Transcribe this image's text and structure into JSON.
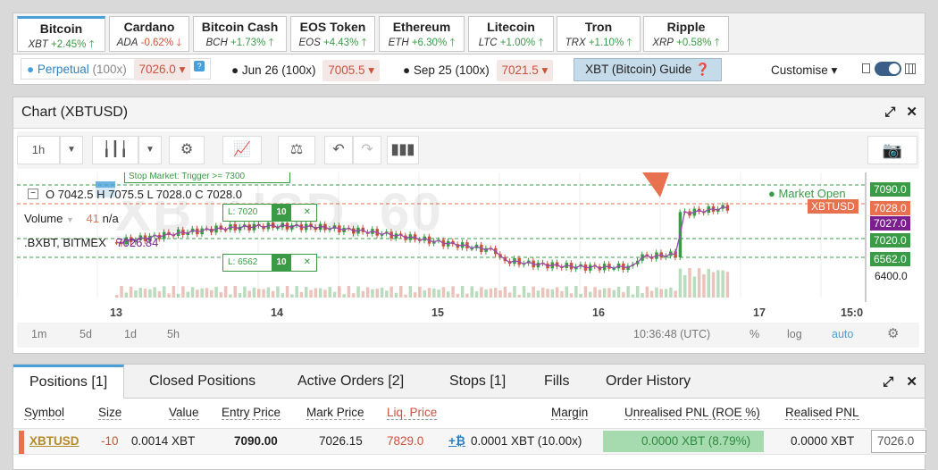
{
  "tabs": [
    {
      "name": "Bitcoin",
      "code": "XBT",
      "change": "+2.45%",
      "dir": "up",
      "arrow": "🡑"
    },
    {
      "name": "Cardano",
      "code": "ADA",
      "change": "-0.62%",
      "dir": "dn",
      "arrow": "🡓"
    },
    {
      "name": "Bitcoin Cash",
      "code": "BCH",
      "change": "+1.73%",
      "dir": "up",
      "arrow": "🡑"
    },
    {
      "name": "EOS Token",
      "code": "EOS",
      "change": "+4.43%",
      "dir": "up",
      "arrow": "🡑"
    },
    {
      "name": "Ethereum",
      "code": "ETH",
      "change": "+6.30%",
      "dir": "up",
      "arrow": "🡑"
    },
    {
      "name": "Litecoin",
      "code": "LTC",
      "change": "+1.00%",
      "dir": "up",
      "arrow": "🡑"
    },
    {
      "name": "Tron",
      "code": "TRX",
      "change": "+1.10%",
      "dir": "up",
      "arrow": "🡑"
    },
    {
      "name": "Ripple",
      "code": "XRP",
      "change": "+0.58%",
      "dir": "up",
      "arrow": "🡑"
    }
  ],
  "contracts": {
    "perpetual": {
      "label": "Perpetual",
      "lev": "(100x)",
      "price": "7026.0"
    },
    "jun": {
      "label": "Jun 26 (100x)",
      "price": "7005.5"
    },
    "sep": {
      "label": "Sep 25 (100x)",
      "price": "7021.5"
    },
    "guide": "XBT (Bitcoin) Guide",
    "customise": "Customise"
  },
  "chart": {
    "title": "Chart (XBTUSD)",
    "interval": "1h",
    "ohlc": "O 7042.5 H 7075.5 L 7028.0 C 7028.0",
    "volume_label": "Volume",
    "volume_val": "41",
    "volume_na": "n/a",
    "index": ".BXBT, BITMEX",
    "index_val": "7026.84",
    "watermark": "XBTUSD, 60",
    "market_open": "Market Open",
    "stop_label": "Stop Market: Trigger >= 7300",
    "ord1": "L: 7020",
    "ord1q": "10",
    "ord2": "L: 6562",
    "ord2q": "10",
    "times": [
      "1m",
      "5d",
      "1d",
      "5h"
    ],
    "clock": "10:36:48 (UTC)",
    "pct": "%",
    "log": "log",
    "auto": "auto",
    "price_badges": [
      {
        "v": "7090.0",
        "c": "#3a9a46"
      },
      {
        "v": "XBTUSD",
        "c": "#e8724f"
      },
      {
        "v": "7028.0",
        "c": "#e8724f"
      },
      {
        "v": "7027.0",
        "c": "#7b1f8f"
      },
      {
        "v": "7020.0",
        "c": "#3a9a46"
      },
      {
        "v": "6562.0",
        "c": "#3a9a46"
      }
    ],
    "axis_label": "6400.0",
    "dates": [
      "13",
      "14",
      "15",
      "16",
      "17",
      "15:0"
    ]
  },
  "positions": {
    "tabs": [
      "Positions [1]",
      "Closed Positions",
      "Active Orders [2]",
      "Stops [1]",
      "Fills",
      "Order History"
    ],
    "headers": [
      "Symbol",
      "Size",
      "Value",
      "Entry Price",
      "Mark Price",
      "Liq. Price",
      "Margin",
      "Unrealised PNL (ROE %)",
      "Realised PNL"
    ],
    "row": {
      "symbol": "XBTUSD",
      "size": "-10",
      "value": "0.0014 XBT",
      "entry": "7090.00",
      "mark": "7026.15",
      "liq": "7829.0",
      "margin": "0.0001 XBT (10.00x)",
      "upnl": "0.0000 XBT (8.79%)",
      "rpnl": "0.0000 XBT",
      "close": "7026.0"
    }
  }
}
